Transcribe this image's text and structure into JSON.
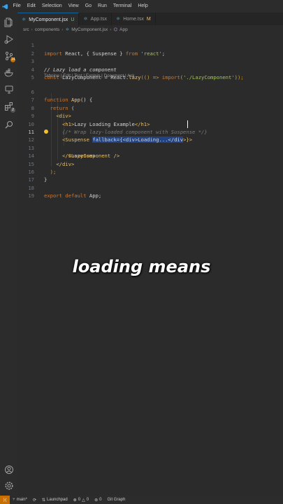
{
  "menu": [
    "File",
    "Edit",
    "Selection",
    "View",
    "Go",
    "Run",
    "Terminal",
    "Help"
  ],
  "tabs": [
    {
      "name": "MyComponent.jsx",
      "status": "U",
      "active": true
    },
    {
      "name": "App.tsx",
      "status": "",
      "active": false
    },
    {
      "name": "Home.tsx",
      "status": "M",
      "active": false
    }
  ],
  "breadcrumb": [
    "src",
    "components",
    "MyComponent.jsx",
    "App"
  ],
  "activity_badges": {
    "source_control": "14",
    "extensions": "2"
  },
  "codelens": "Tabnine | Edit | Test | Explain | Document | Ask",
  "line_numbers": [
    "1",
    "2",
    "3",
    "4",
    "5",
    "6",
    "7",
    "8",
    "9",
    "10",
    "11",
    "12",
    "13",
    "14",
    "15",
    "16",
    "17",
    "18",
    "19"
  ],
  "code": {
    "l1_kw": "import",
    "l1_mid": " React, { Suspense } ",
    "l1_from": "from",
    "l1_str": " 'react'",
    "l1_end": ";",
    "l3": "// Lazy load a component",
    "l4_kw": "const",
    "l4_mid": " LazyComponent = React.",
    "l4_fn": "lazy",
    "l4_rest": "(() => ",
    "l4_import": "import",
    "l4_str": "('./LazyComponent')",
    "l4_end": ");",
    "l5_kw": "function",
    "l5_fn": " App",
    "l5_end": "() {",
    "l6_kw": "return",
    "l6_end": " (",
    "l7": "<div>",
    "l8_open": "<h1>",
    "l8_text": "Lazy Loading Example",
    "l8_close": "</h1>",
    "l9": "{/* Wrap lazy-loaded component with Suspense */}",
    "l10_tag": "<Suspense ",
    "l10_sel": "fallback={<div>Loading...</div",
    "l10_end": ">}>",
    "l11": "<LazyComponent />",
    "l12": "</Suspense>",
    "l13": "</div>",
    "l14": ");",
    "l15": "}",
    "l17_kw": "export default",
    "l17_rest": " App;"
  },
  "caption": "loading means",
  "status": {
    "branch": "main*",
    "launchpad": "Launchpad",
    "errors": "0",
    "warnings": "0",
    "ports": "0",
    "git_graph": "Git Graph"
  },
  "colors": {
    "accent": "#0e639c",
    "selection": "#214283",
    "remote": "#c76f00"
  }
}
